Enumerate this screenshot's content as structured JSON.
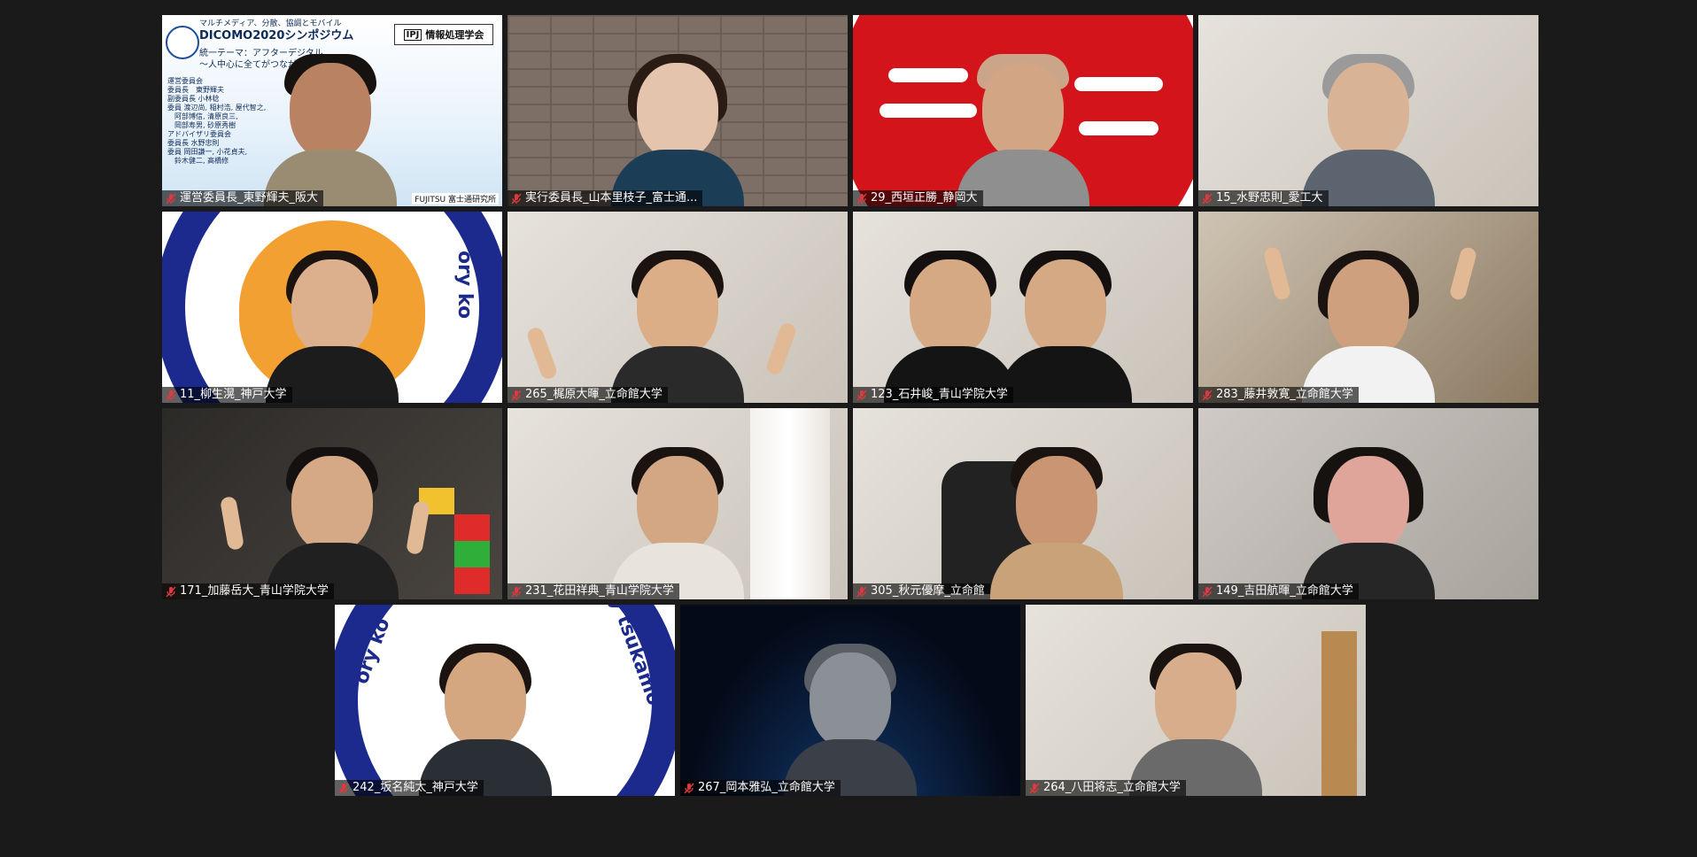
{
  "meeting": {
    "background_color": "#1a1a1a",
    "label_color": "#ffffff",
    "muted_icon_color": "#e0383e"
  },
  "slide": {
    "subtitle": "マルチメディア、分散、協調とモバイル",
    "title": "DICOMO2020シンポジウム",
    "theme": "統一テーマ：アフターデジタル",
    "theme_sub": "～人中心に全てがつながる情報技術～",
    "org": "情報処理学会",
    "committee_lines": [
      "運営委員会",
      "委員長　東野輝夫",
      "副委員長 小林稔",
      "委員 渡辺尚, 稲村浩, 屋代智之,",
      "　阿部博信, 清原良三,",
      "　岡部寿男, 砂原秀樹",
      "アドバイザリ委員会",
      "委員長 水野忠則",
      "委員 岡田謙一, 小花貞夫,",
      "　鈴木健二, 高橋修"
    ],
    "sponsor": "FUJITSU 富士通研究所"
  },
  "participants": [
    {
      "name": "運営委員長_東野輝夫_阪大",
      "muted": true
    },
    {
      "name": "実行委員長_山本里枝子_富士通...",
      "muted": true
    },
    {
      "name": "29_西垣正勝_静岡大",
      "muted": true
    },
    {
      "name": "15_水野忠則_愛工大",
      "muted": true
    },
    {
      "name": "11_柳生滉_神戸大学",
      "muted": true
    },
    {
      "name": "265_梶原大暉_立命館大学",
      "muted": true
    },
    {
      "name": "123_石井峻_青山学院大学",
      "muted": true
    },
    {
      "name": "283_藤井敦寛_立命館大学",
      "muted": true
    },
    {
      "name": "171_加藤岳大_青山学院大学",
      "muted": true
    },
    {
      "name": "231_花田祥典_青山学院大学",
      "muted": true
    },
    {
      "name": "305_秋元優摩_立命館",
      "muted": true
    },
    {
      "name": "149_吉田航暉_立命館大学",
      "muted": true
    },
    {
      "name": "242_坂名純太_神戸大学",
      "muted": true
    },
    {
      "name": "267_岡本雅弘_立命館大学",
      "muted": true
    },
    {
      "name": "264_八田将志_立命館大学",
      "muted": true
    }
  ],
  "lab_logo": {
    "ring_text_left": "ory ko",
    "ring_text_right": "y tsukamo"
  }
}
